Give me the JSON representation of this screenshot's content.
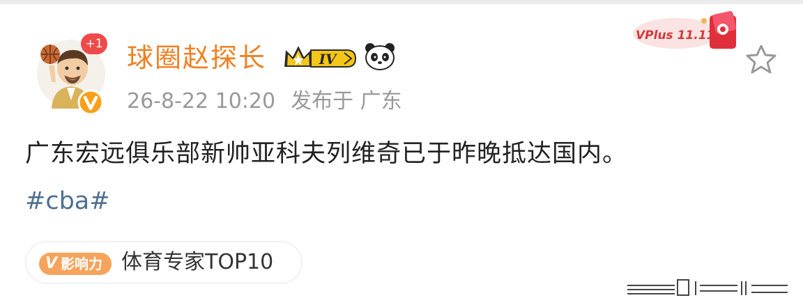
{
  "post": {
    "username": "球圈赵探长",
    "level_badge": "IV",
    "plus_badge": "+1",
    "date": "26-8-22 10:20",
    "published_from": "发布于 广东",
    "content": "广东宏远俱乐部新帅亚科夫列维奇已于昨晚抵达国内。",
    "topic": "#cba#",
    "influence": {
      "badge_v": "V",
      "badge_text": "影响力",
      "label": "体育专家TOP10"
    },
    "promo_text": "VPlus 11.11"
  },
  "colors": {
    "username": "#f08022",
    "meta": "#999999",
    "topic": "#4f6f93",
    "badge_orange": "#f7a35c",
    "plus_badge": "#ee4a4a"
  },
  "icons": [
    "avatar",
    "verified-v-icon",
    "crown-level-badge",
    "panda-icon",
    "star-icon",
    "vplus-promo-icon"
  ]
}
